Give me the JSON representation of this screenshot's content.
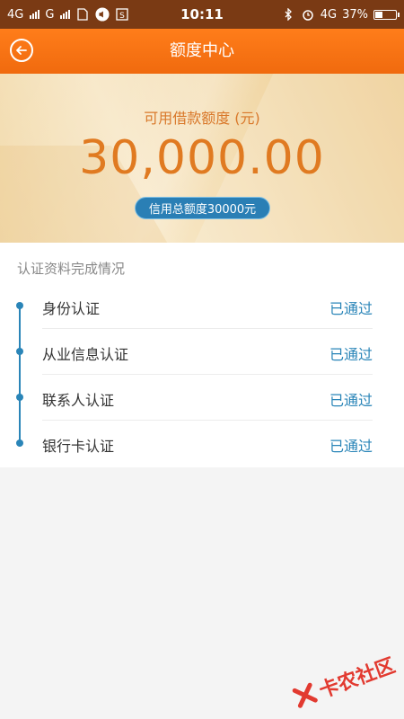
{
  "status_bar": {
    "network_left": "4G",
    "network_right": "G",
    "time": "10:11",
    "network_4g": "4G",
    "battery": "37%"
  },
  "header": {
    "title": "额度中心"
  },
  "hero": {
    "label": "可用借款额度 (元)",
    "amount": "30,000.00",
    "credit_badge": "信用总额度30000元"
  },
  "section": {
    "title": "认证资料完成情况",
    "items": [
      {
        "name": "身份认证",
        "status": "已通过"
      },
      {
        "name": "从业信息认证",
        "status": "已通过"
      },
      {
        "name": "联系人认证",
        "status": "已通过"
      },
      {
        "name": "银行卡认证",
        "status": "已通过"
      }
    ]
  },
  "watermark": {
    "text": "卡农社区"
  },
  "colors": {
    "header": "#f06a0e",
    "accent_blue": "#2a85b8",
    "amount": "#e07a21"
  }
}
